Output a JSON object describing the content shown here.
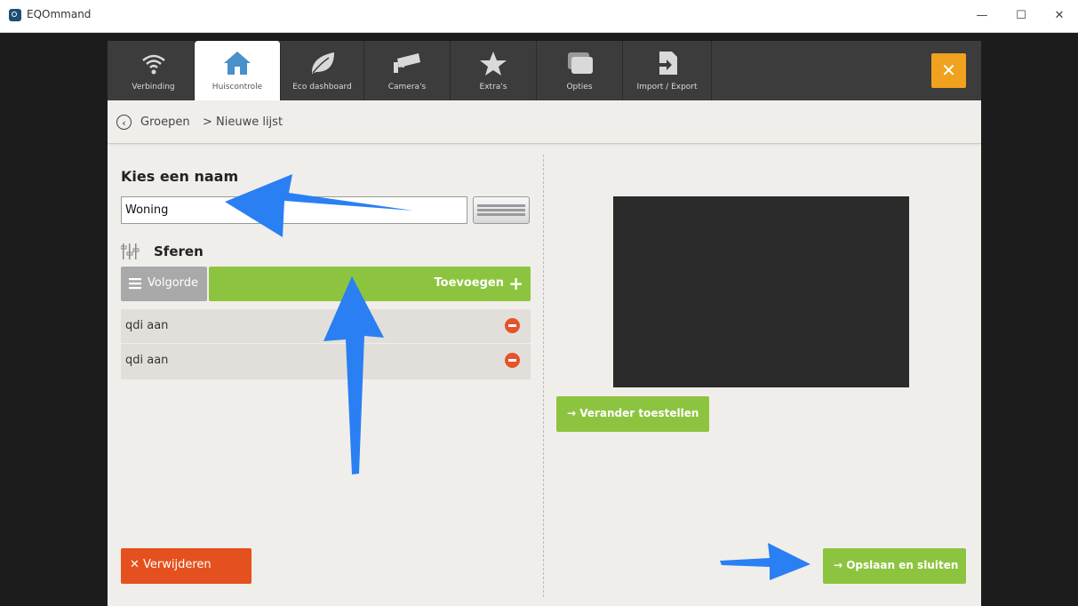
{
  "window": {
    "title": "EQOmmand",
    "minimize_glyph": "—",
    "maximize_glyph": "☐",
    "close_glyph": "✕"
  },
  "nav": {
    "tabs": [
      {
        "label": "Verbinding",
        "icon": "wifi-icon",
        "active": false
      },
      {
        "label": "Huiscontrole",
        "icon": "home-icon",
        "active": true
      },
      {
        "label": "Eco dashboard",
        "icon": "leaf-icon",
        "active": false
      },
      {
        "label": "Camera's",
        "icon": "camera-icon",
        "active": false
      },
      {
        "label": "Extra's",
        "icon": "star-icon",
        "active": false
      },
      {
        "label": "Opties",
        "icon": "windows-icon",
        "active": false
      },
      {
        "label": "Import / Export",
        "icon": "import-export-icon",
        "active": false
      }
    ],
    "close_glyph": "✕",
    "accent_color": "#f0a11e"
  },
  "breadcrumb": {
    "back_glyph": "‹",
    "parent": "Groepen",
    "separator": ">",
    "current": "Nieuwe lijst"
  },
  "form": {
    "name_label": "Kies een naam",
    "name_value": "Woning",
    "keyboard_icon": "keyboard-icon",
    "section_label": "Sferen",
    "section_icon": "mixer-icon",
    "order_label": "Volgorde",
    "add_label": "Toevoegen",
    "add_glyph": "+",
    "items": [
      {
        "label": "qdi aan"
      },
      {
        "label": "qdi aan"
      }
    ]
  },
  "right": {
    "change_label": "→  Verander toestellen"
  },
  "footer": {
    "delete_label": "✕  Verwijderen",
    "save_label": "→  Opslaan en sluiten"
  },
  "colors": {
    "green": "#8dc43f",
    "red": "#e4511e",
    "orange": "#f0a11e",
    "annotation_blue": "#2a7ff2"
  }
}
